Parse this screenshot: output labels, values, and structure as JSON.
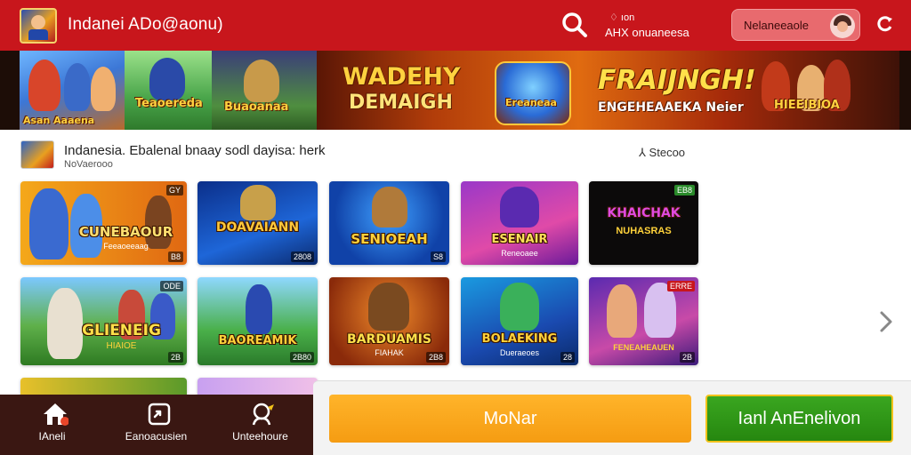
{
  "header": {
    "app_title": "Indanei ADo@aonu)",
    "lang_top": "♢ ıon",
    "lang_bottom": "AHX onuaneesa",
    "user_name": "Nelaneeaole",
    "colors": {
      "header_bg": "#c8161c",
      "user_pill_bg": "#e86a6e"
    }
  },
  "banner": {
    "left_label_1": "Asan Aaaena",
    "left_label_2": "Teaoereda",
    "left_label_3": "Buaoanaa",
    "center_line_1": "WADEHY",
    "center_line_2": "DEMAIGH",
    "badge_label": "Ereaneaa",
    "right_line_1": "FRAIJNGH!",
    "right_line_2": "ENGEHEAAEKA Neier",
    "right_label": "HIEEIBIOA"
  },
  "category": {
    "title": "Indanesia. Ebalenal bnaay sodl dayisa: herk",
    "subtitle": "NoVaerooo",
    "sort_label": "⅄ Stecoo"
  },
  "games": [
    {
      "title": "CUNEBAOUR",
      "sub": "Feeaoeeaag",
      "badge": "GY",
      "code": "B8"
    },
    {
      "title": "DOAVAIANN",
      "sub": "",
      "badge": "",
      "code": "2808"
    },
    {
      "title": "SENIOEAH",
      "sub": "",
      "badge": "",
      "code": "S8"
    },
    {
      "title": "ESENAIR",
      "sub": "Reneoaee",
      "badge": "",
      "code": ""
    },
    {
      "title": "KHAICHAK",
      "sub": "NUHASRAS",
      "badge": "EB8",
      "code": ""
    },
    {
      "title": "GLIENEIG",
      "sub": "HIAIOE",
      "badge": "ODE",
      "code": "2B"
    },
    {
      "title": "BAOREAMIK",
      "sub": "",
      "badge": "",
      "code": "2B80"
    },
    {
      "title": "BARDUAMIS",
      "sub": "FIAHAK",
      "badge": "",
      "code": "2B8"
    },
    {
      "title": "BOLAEKING",
      "sub": "Dueraeoes",
      "badge": "",
      "code": "28"
    },
    {
      "title": "",
      "sub": "FENEAHEAUEN",
      "badge": "ERRE",
      "code": "2B"
    }
  ],
  "bottom_nav": {
    "items": [
      {
        "label": "IAneli",
        "icon": "home-icon"
      },
      {
        "label": "Eanoacusien",
        "icon": "share-icon"
      },
      {
        "label": "Unteehoure",
        "icon": "chat-icon"
      }
    ]
  },
  "actions": {
    "orange_label": "MoNar",
    "green_label": "Ianl AnEnelivon",
    "colors": {
      "orange": "#f59c12",
      "green": "#26870f"
    }
  }
}
